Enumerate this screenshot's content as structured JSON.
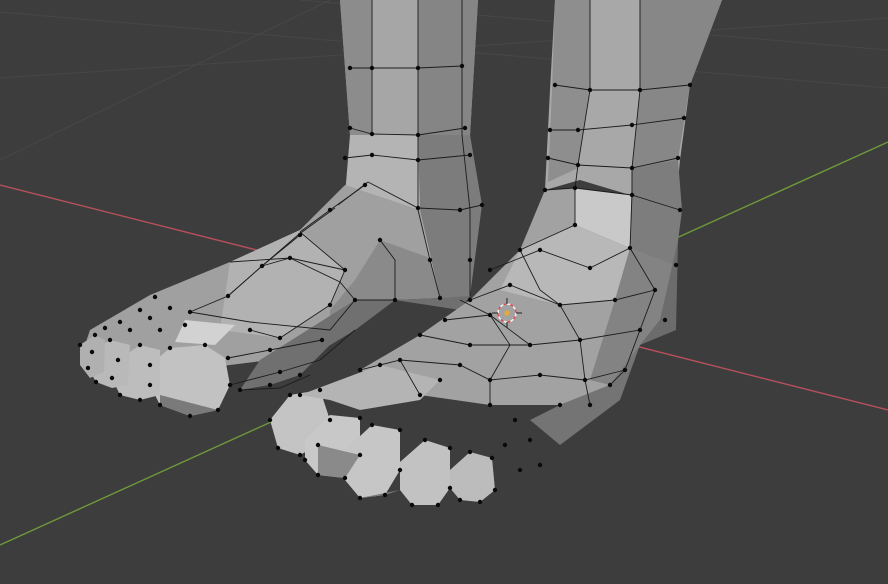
{
  "viewport": {
    "mode": "edit-mode",
    "object": "feet-mesh",
    "background_color": "#3d3d3d",
    "grid_color": "#484848",
    "x_axis_color": "#b8505c",
    "y_axis_color": "#6e9a3a",
    "mesh_face_color": "#9a9a9a",
    "mesh_face_light": "#c8c8c8",
    "mesh_face_dark": "#6e6e6e",
    "vertex_color": "#0a0a0a",
    "cursor_color": "#e05050",
    "cursor_center_color": "#e8a838",
    "icons": [
      "3d-cursor-icon"
    ]
  }
}
